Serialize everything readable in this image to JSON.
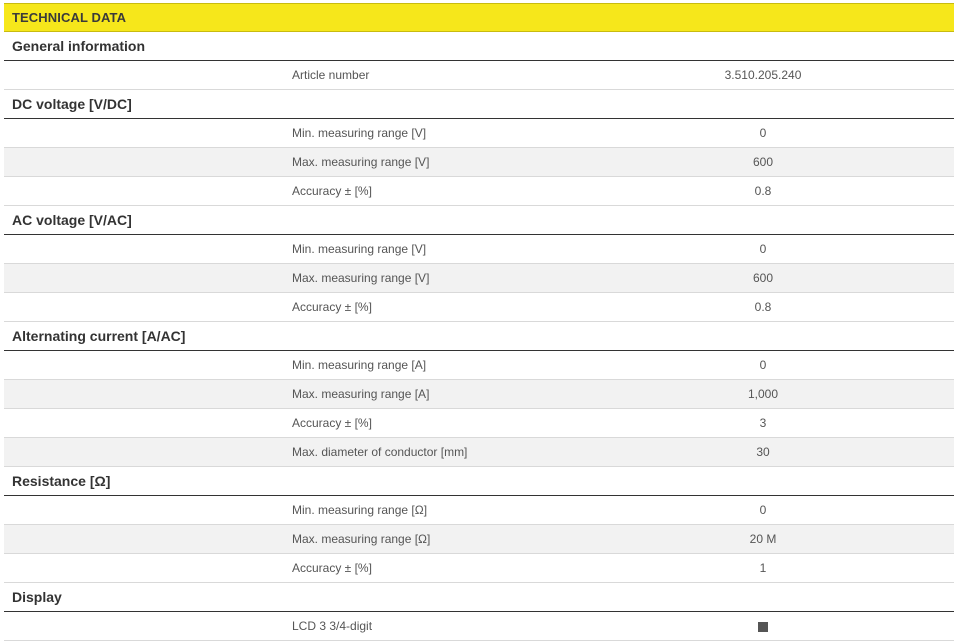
{
  "header": {
    "title": "TECHNICAL DATA"
  },
  "sections": {
    "general": {
      "title": "General information",
      "rows": [
        {
          "label": "Article number",
          "value": "3.510.205.240"
        }
      ]
    },
    "dc": {
      "title": "DC voltage [V/DC]",
      "rows": [
        {
          "label": "Min. measuring range [V]",
          "value": "0"
        },
        {
          "label": "Max. measuring range [V]",
          "value": "600"
        },
        {
          "label": "Accuracy ± [%]",
          "value": "0.8"
        }
      ]
    },
    "ac": {
      "title": "AC voltage [V/AC]",
      "rows": [
        {
          "label": "Min. measuring range [V]",
          "value": "0"
        },
        {
          "label": "Max. measuring range [V]",
          "value": "600"
        },
        {
          "label": "Accuracy ± [%]",
          "value": "0.8"
        }
      ]
    },
    "current": {
      "title": "Alternating current [A/AC]",
      "rows": [
        {
          "label": "Min. measuring range [A]",
          "value": "0"
        },
        {
          "label": "Max. measuring range [A]",
          "value": "1,000"
        },
        {
          "label": "Accuracy ± [%]",
          "value": "3"
        },
        {
          "label": "Max. diameter of conductor [mm]",
          "value": "30"
        }
      ]
    },
    "resistance": {
      "title": "Resistance [Ω]",
      "rows": [
        {
          "label": "Min. measuring range [Ω]",
          "value": "0"
        },
        {
          "label": "Max. measuring range [Ω]",
          "value": "20 M"
        },
        {
          "label": "Accuracy ± [%]",
          "value": "1"
        }
      ]
    },
    "display": {
      "title": "Display",
      "rows": [
        {
          "label": "LCD 3 3/4-digit",
          "icon": "filled-square-icon"
        }
      ]
    }
  },
  "colors": {
    "header_bg": "#f6e71b",
    "alt_row_bg": "#f2f2f2",
    "section_rule": "#333333"
  }
}
